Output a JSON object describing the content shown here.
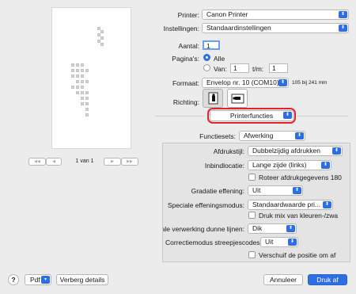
{
  "preview": {
    "prev_first": "◀◀",
    "prev": "◀",
    "page_indicator": "1 van 1",
    "next": "▶",
    "next_last": "▶▶"
  },
  "printer": {
    "label": "Printer:",
    "value": "Canon Printer"
  },
  "settings": {
    "label": "Instellingen:",
    "value": "Standaardinstellingen"
  },
  "copies": {
    "label": "Aantal:",
    "value": "1"
  },
  "pages": {
    "label": "Pagina's:",
    "all_label": "Alle",
    "from_label": "Van:",
    "from_value": "1",
    "to_label": "t/m:",
    "to_value": "1"
  },
  "format": {
    "label": "Formaat:",
    "value": "Envelop nr. 10 (COM10)",
    "size_text": "105 bij 241 mm"
  },
  "orientation": {
    "label": "Richting:"
  },
  "section": {
    "value": "Printerfuncties"
  },
  "feature_sets": {
    "label": "Functiesets:",
    "value": "Afwerking"
  },
  "options": {
    "print_style": {
      "label": "Afdrukstijl:",
      "value": "Dubbelzijdig afdrukken"
    },
    "binding": {
      "label": "Inbindlocatie:",
      "value": "Lange zijde (links)"
    },
    "rotate_label": "Roteer afdrukgegevens 180",
    "gradation": {
      "label": "Gradatie effening:",
      "value": "Uit"
    },
    "special_smoothing": {
      "label": "Speciale effeningsmodus:",
      "value": "Standaardwaarde pri..."
    },
    "color_mix_label": "Druk mix van kleuren-/zwa",
    "thin_lines": {
      "label": "Speciale verwerking dunne lijnen:",
      "value": "Dik"
    },
    "barcode": {
      "label": "Correctiemodus streepjescodes:",
      "value": "Uit"
    },
    "shift_label": "Verschuif de positie om af"
  },
  "footer": {
    "help": "?",
    "pdf": "Pdf",
    "hide_details": "Verberg details",
    "cancel": "Annuleer",
    "print": "Druk af"
  },
  "colors": {
    "accent": "#2d6ee3",
    "highlight": "#e0262a"
  }
}
